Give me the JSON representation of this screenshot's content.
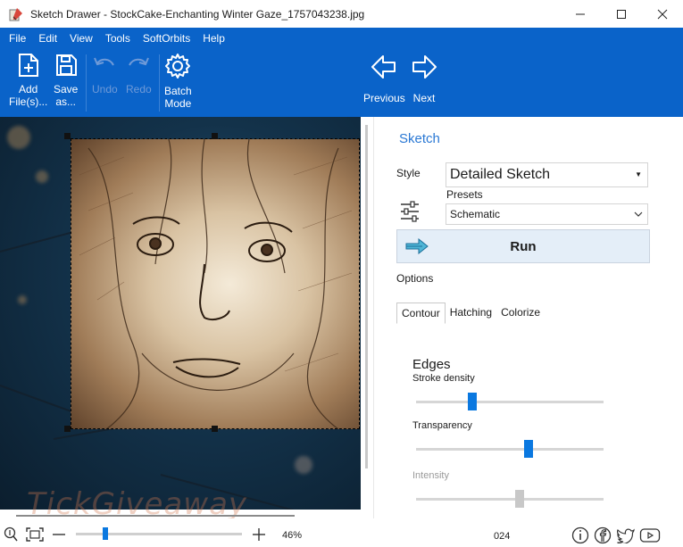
{
  "window": {
    "title": "Sketch Drawer - StockCake-Enchanting Winter Gaze_1757043238.jpg"
  },
  "menu": [
    "File",
    "Edit",
    "View",
    "Tools",
    "SoftOrbits",
    "Help"
  ],
  "toolbar": {
    "add_files_line1": "Add",
    "add_files_line2": "File(s)...",
    "save_as_line1": "Save",
    "save_as_line2": "as...",
    "undo": "Undo",
    "redo": "Redo",
    "batch_line1": "Batch",
    "batch_line2": "Mode",
    "previous": "Previous",
    "next": "Next"
  },
  "panel": {
    "title": "Sketch",
    "style_label": "Style",
    "style_value": "Detailed Sketch",
    "presets_label": "Presets",
    "presets_value": "Schematic",
    "run_label": "Run",
    "options_label": "Options",
    "tabs": [
      "Contour",
      "Hatching",
      "Colorize"
    ],
    "active_tab": "Contour",
    "section": "Edges",
    "sliders": [
      {
        "label": "Stroke density",
        "value": 0.3,
        "enabled": true
      },
      {
        "label": "Transparency",
        "value": 0.6,
        "enabled": true
      },
      {
        "label": "Intensity",
        "value": 0.55,
        "enabled": false
      }
    ]
  },
  "status": {
    "zoom": "46%",
    "zoom_value": 0.18,
    "counter": "024",
    "watermark": "TickGiveaway"
  },
  "colors": {
    "accent": "#0a63c9",
    "slider": "#0a78e0"
  }
}
